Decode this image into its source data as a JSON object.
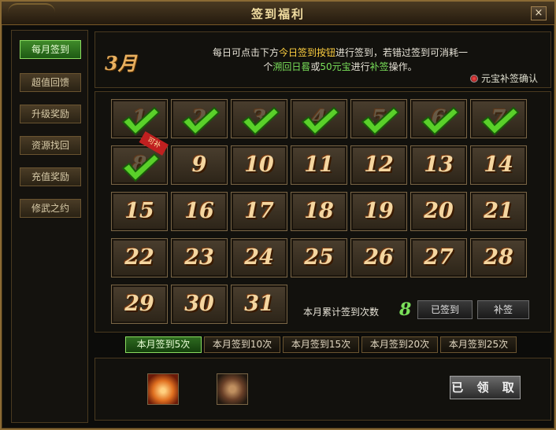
{
  "window": {
    "title": "签到福利",
    "close_label": "×"
  },
  "sidebar": {
    "items": [
      {
        "label": "每月签到",
        "active": true
      },
      {
        "label": "超值回馈"
      },
      {
        "label": "升级奖励"
      },
      {
        "label": "资源找回"
      },
      {
        "label": "充值奖励"
      },
      {
        "label": "修武之约"
      }
    ]
  },
  "header": {
    "month": "3月",
    "desc_1": "每日可点击下方",
    "desc_hl": "今日签到按钮",
    "desc_2": "进行签到，若错过签到可消耗一",
    "desc_3": "个",
    "desc_item1": "溯回日晷",
    "desc_4": "或",
    "desc_item2": "50元宝",
    "desc_5": "进行",
    "desc_item3": "补签",
    "desc_6": "操作。",
    "confirm_label": "元宝补签确认"
  },
  "calendar": {
    "days": [
      "1",
      "2",
      "3",
      "4",
      "5",
      "6",
      "7",
      "8",
      "9",
      "10",
      "11",
      "12",
      "13",
      "14",
      "15",
      "16",
      "17",
      "18",
      "19",
      "20",
      "21",
      "22",
      "23",
      "24",
      "25",
      "26",
      "27",
      "28",
      "29",
      "30",
      "31"
    ],
    "signed_count": 8,
    "today_ribbon": "可补",
    "total_label": "本月累计签到次数",
    "total_value": "8",
    "signed_button": "已签到",
    "makeup_button": "补签"
  },
  "tabs": [
    {
      "label": "本月签到5次",
      "active": true
    },
    {
      "label": "本月签到10次"
    },
    {
      "label": "本月签到15次"
    },
    {
      "label": "本月签到20次"
    },
    {
      "label": "本月签到25次"
    }
  ],
  "rewards": {
    "items": [
      "gold-nugget-pile-icon",
      "teapot-icon"
    ],
    "claim_button": "已 领 取"
  },
  "colors": {
    "accent_green": "#7ae05a",
    "highlight_yellow": "#ffd040",
    "frame_gold": "#8a6a34"
  }
}
